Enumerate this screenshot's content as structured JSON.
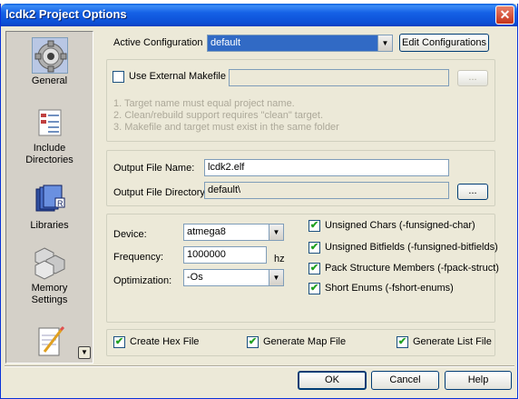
{
  "window": {
    "title": "lcdk2 Project Options",
    "close_label": "✕"
  },
  "sidebar": {
    "items": [
      {
        "label": "General",
        "icon": "gear-icon"
      },
      {
        "label": "Include Directories",
        "label_line1": "Include",
        "label_line2": "Directories",
        "icon": "folder-list-icon"
      },
      {
        "label": "Libraries",
        "icon": "books-icon"
      },
      {
        "label": "Memory Settings",
        "label_line1": "Memory",
        "label_line2": "Settings",
        "icon": "cubes-icon"
      },
      {
        "label": "",
        "icon": "notepad-icon"
      }
    ],
    "scroll_label": "▼"
  },
  "config": {
    "label": "Active Configuration",
    "value": "default",
    "edit_button": "Edit Configurations"
  },
  "makefile": {
    "checkbox_label": "Use External Makefile",
    "checked": false,
    "path_value": "",
    "browse_label": "...",
    "notes": [
      "1. Target name must equal project name.",
      "2. Clean/rebuild support requires \"clean\" target.",
      "3. Makefile and target must exist in the same folder"
    ]
  },
  "output": {
    "file_name_label": "Output File Name:",
    "file_name_value": "lcdk2.elf",
    "dir_label": "Output File Directory:",
    "dir_value": "default\\",
    "browse_label": "..."
  },
  "device": {
    "device_label": "Device:",
    "device_value": "atmega8",
    "frequency_label": "Frequency:",
    "frequency_value": "1000000",
    "frequency_unit": "hz",
    "optimization_label": "Optimization:",
    "optimization_value": "-Os"
  },
  "options": [
    {
      "label": "Unsigned Chars (-funsigned-char)",
      "checked": true
    },
    {
      "label": "Unsigned Bitfields (-funsigned-bitfields)",
      "checked": true
    },
    {
      "label": "Pack Structure Members (-fpack-struct)",
      "checked": true
    },
    {
      "label": "Short Enums (-fshort-enums)",
      "checked": true
    }
  ],
  "generate": [
    {
      "label": "Create Hex File",
      "checked": true
    },
    {
      "label": "Generate Map File",
      "checked": true
    },
    {
      "label": "Generate List File",
      "checked": true
    }
  ],
  "footer": {
    "ok": "OK",
    "cancel": "Cancel",
    "help": "Help"
  },
  "check_glyph": "✔"
}
